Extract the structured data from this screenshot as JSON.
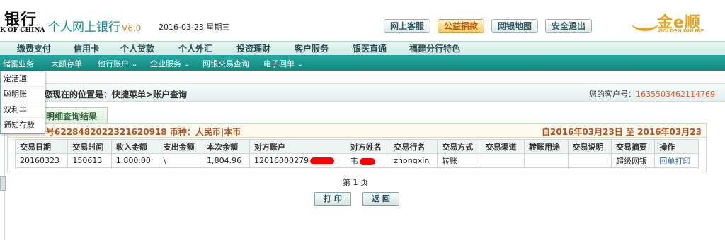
{
  "header": {
    "logo_cn": "银行",
    "logo_en": "K OF CHINA",
    "app_title": "个人网上银行",
    "app_version": "V6.0",
    "date": "2016-03-23 星期三",
    "buttons": [
      "网上客服",
      "公益捐款",
      "网银地图",
      "安全退出"
    ],
    "partner_logo_cn": "金e顺",
    "partner_logo_en": "GOLDEN ONLINE"
  },
  "nav_main": [
    "缴费支付",
    "信用卡",
    "个人贷款",
    "个人外汇",
    "投资理财",
    "客户服务",
    "银医直通",
    "福建分行特色"
  ],
  "nav_sub": [
    "储蓄业务",
    "大额存单",
    "他行账户 ⌄",
    "企业服务 ⌄",
    "网银交易查询",
    "电子回单 ⌄"
  ],
  "dropdown": [
    "定活通",
    "聪明账",
    "双利丰",
    "通知存款"
  ],
  "location": {
    "text": "您现在的位置是：快捷菜单>账户查询",
    "account_label": "您的客户号：",
    "account_no": "1635503462114769"
  },
  "tab_label": "明细查询结果",
  "result": {
    "account_text": "号6228482022321620918 币种：人民币|本币",
    "range_text": "自2016年03月23日  至  2016年03月23日",
    "columns": [
      "交易日期",
      "交易时间",
      "收入金额",
      "支出金额",
      "本次余额",
      "对方账户",
      "对方姓名",
      "交易行名",
      "交易方式",
      "交易渠道",
      "转账用途",
      "交易说明",
      "交易摘要",
      "操作"
    ],
    "row": {
      "date": "20160323",
      "time": "150613",
      "income": "1,800.00",
      "expense": "\\",
      "balance": "1,804.96",
      "counter_account": "12016000279",
      "counter_name": "韦",
      "bank_name": "zhongxin",
      "method": "转账",
      "channel": "",
      "purpose": "",
      "desc": "",
      "summary": "超级网银",
      "action": "回单打印"
    }
  },
  "pagination": "第 1 页",
  "bottom_buttons": [
    "打 印",
    "返 回"
  ],
  "colors": {
    "teal_nav": "#108982",
    "accent_orange": "#e05a2a",
    "brand_gold": "#e6a31a"
  }
}
